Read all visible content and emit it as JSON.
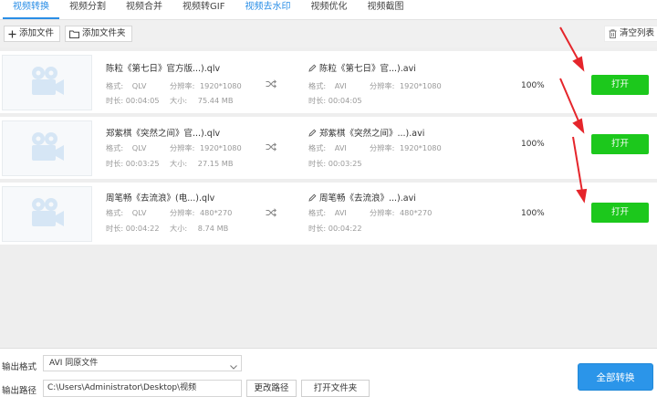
{
  "tabs": [
    {
      "label": "视频转换"
    },
    {
      "label": "视频分割"
    },
    {
      "label": "视频合并"
    },
    {
      "label": "视频转GIF"
    },
    {
      "label": "视频去水印"
    },
    {
      "label": "视频优化"
    },
    {
      "label": "视频截图"
    }
  ],
  "toolbar": {
    "add_file": "添加文件",
    "add_folder": "添加文件夹",
    "clear_list": "清空列表"
  },
  "meta_labels": {
    "format": "格式:",
    "resolution": "分辨率:",
    "duration": "时长:",
    "size": "大小:"
  },
  "files": [
    {
      "source_name": "陈粒《第七日》官方版...).qlv",
      "source_format": "QLV",
      "source_resolution": "1920*1080",
      "source_duration": "00:04:05",
      "source_size": "75.44 MB",
      "output_name": "陈粒《第七日》官...).avi",
      "output_format": "AVI",
      "output_resolution": "1920*1080",
      "output_duration": "00:04:05",
      "progress": "100%",
      "open_label": "打开"
    },
    {
      "source_name": "郑紫棋《突然之间》官...).qlv",
      "source_format": "QLV",
      "source_resolution": "1920*1080",
      "source_duration": "00:03:25",
      "source_size": "27.15 MB",
      "output_name": "郑紫棋《突然之间》...).avi",
      "output_format": "AVI",
      "output_resolution": "1920*1080",
      "output_duration": "00:03:25",
      "progress": "100%",
      "open_label": "打开"
    },
    {
      "source_name": "周笔畅《去流浪》(电...).qlv",
      "source_format": "QLV",
      "source_resolution": "480*270",
      "source_duration": "00:04:22",
      "source_size": "8.74 MB",
      "output_name": "周笔畅《去流浪》...).avi",
      "output_format": "AVI",
      "output_resolution": "480*270",
      "output_duration": "00:04:22",
      "progress": "100%",
      "open_label": "打开"
    }
  ],
  "output": {
    "format_label": "输出格式",
    "format_value": "AVI  同原文件",
    "path_label": "输出路径",
    "path_value": "C:\\Users\\Administrator\\Desktop\\视频",
    "change_path": "更改路径",
    "open_folder": "打开文件夹",
    "convert_all": "全部转换"
  },
  "colors": {
    "accent_blue": "#2a8ee6",
    "open_green": "#1cc81c",
    "annotation_red": "#e5252b"
  }
}
